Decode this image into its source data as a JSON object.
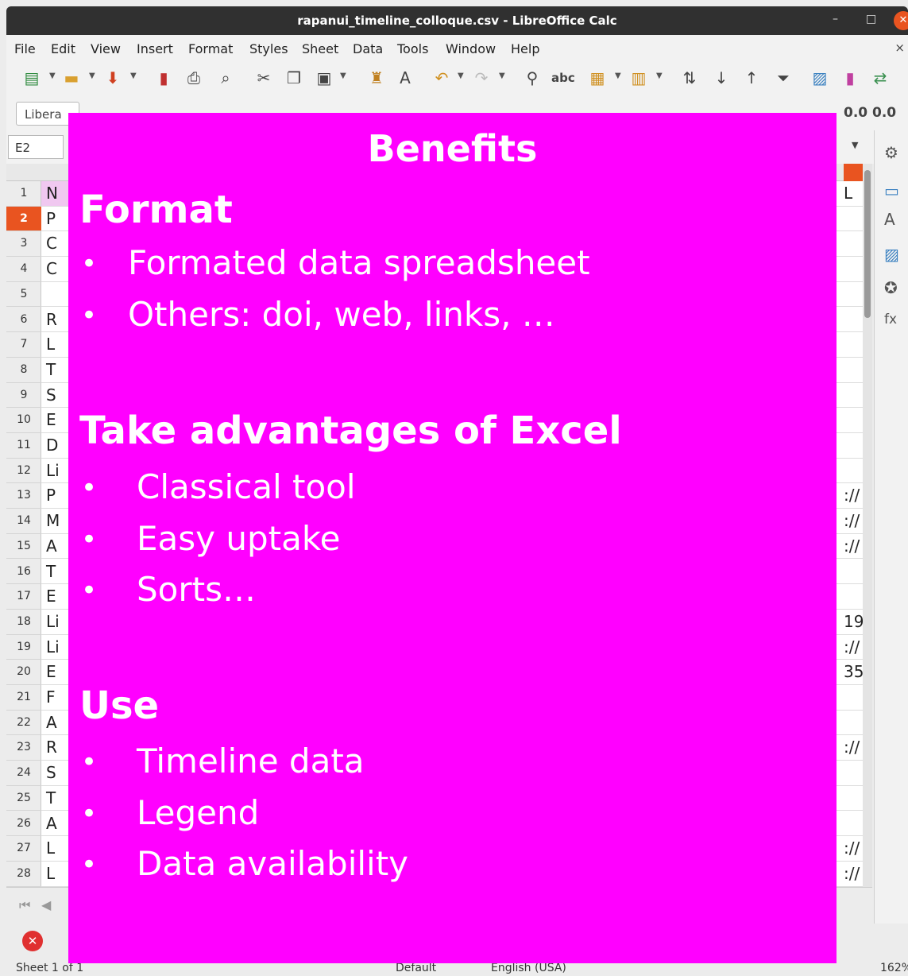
{
  "window": {
    "title": "rapanui_timeline_colloque.csv - LibreOffice Calc",
    "minimize": "–",
    "maximize": "□",
    "close": "✕"
  },
  "menu": [
    "File",
    "Edit",
    "View",
    "Insert",
    "Format",
    "Styles",
    "Sheet",
    "Data",
    "Tools",
    "Window",
    "Help"
  ],
  "menu_close": "×",
  "font_name": "Libera",
  "number_formats": [
    "0.0",
    "0.0"
  ],
  "name_box": "E2",
  "rows": [
    {
      "num": "1",
      "a": "N"
    },
    {
      "num": "2",
      "a": "P"
    },
    {
      "num": "3",
      "a": "C"
    },
    {
      "num": "4",
      "a": "C"
    },
    {
      "num": "5",
      "a": ""
    },
    {
      "num": "6",
      "a": "R"
    },
    {
      "num": "7",
      "a": "L"
    },
    {
      "num": "8",
      "a": "T"
    },
    {
      "num": "9",
      "a": "S"
    },
    {
      "num": "10",
      "a": "E"
    },
    {
      "num": "11",
      "a": "D"
    },
    {
      "num": "12",
      "a": "Li"
    },
    {
      "num": "13",
      "a": "P"
    },
    {
      "num": "14",
      "a": "M"
    },
    {
      "num": "15",
      "a": "A"
    },
    {
      "num": "16",
      "a": "T"
    },
    {
      "num": "17",
      "a": "E"
    },
    {
      "num": "18",
      "a": "Li"
    },
    {
      "num": "19",
      "a": "Li"
    },
    {
      "num": "20",
      "a": "E"
    },
    {
      "num": "21",
      "a": "F"
    },
    {
      "num": "22",
      "a": "A"
    },
    {
      "num": "23",
      "a": "R"
    },
    {
      "num": "24",
      "a": "S"
    },
    {
      "num": "25",
      "a": "T"
    },
    {
      "num": "26",
      "a": "A"
    },
    {
      "num": "27",
      "a": "L"
    },
    {
      "num": "28",
      "a": "L"
    }
  ],
  "right_cells": {
    "r1": "L",
    "r13": "://",
    "r14": "://",
    "r15": "://",
    "r18": "19",
    "r19": "://",
    "r20": "35",
    "r23": "://",
    "r27": "://",
    "r28": "://"
  },
  "status": {
    "sheet": "Sheet 1 of 1",
    "style": "Default",
    "language": "English (USA)",
    "zoom": "162%"
  },
  "slide": {
    "title": "Benefits",
    "sections": [
      {
        "heading": "Format",
        "bullets": [
          "Formated data spreadsheet",
          "Others: doi, web, links, …"
        ]
      },
      {
        "heading": "Take advantages of Excel",
        "bullets": [
          "Classical tool",
          "Easy uptake",
          "Sorts…"
        ]
      },
      {
        "heading": "Use",
        "bullets": [
          "Timeline data",
          "Legend",
          "Data availability"
        ]
      }
    ],
    "bullet_char": "•"
  },
  "colors": {
    "accent": "#e95420",
    "overlay": "#ff00ff"
  }
}
